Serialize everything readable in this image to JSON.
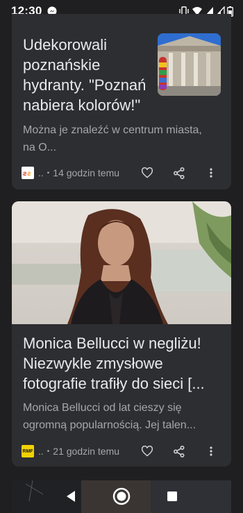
{
  "status_bar": {
    "time": "12:30"
  },
  "articles": [
    {
      "title": "Udekorowali poznańskie hydranty. \"Poznań nabiera kolorów!\"",
      "snippet": "Można je znaleźć w centrum miasta, na O...",
      "source_name": "..",
      "time_ago": "14 godzin temu"
    },
    {
      "title": "Monica Bellucci w negliżu! Niezwykle zmysłowe fotografie trafiły do sieci [...",
      "snippet": "Monica Bellucci od lat cieszy się ogromną popularnością. Jej talen...",
      "source_name": "..",
      "time_ago": "21 godzin temu",
      "source_logo_text": "RMF"
    }
  ],
  "colors": {
    "background": "#1f1f21",
    "card": "#2d2e31",
    "primary_text": "#e8eaed",
    "secondary_text": "#a5a7ab"
  }
}
